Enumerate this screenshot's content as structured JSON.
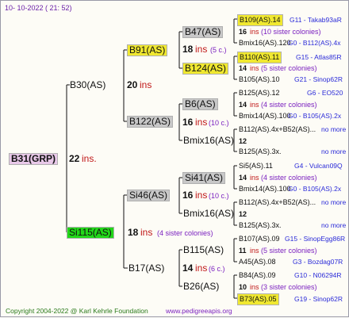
{
  "header": {
    "date": "10- 10-2022 ( 21: 52)"
  },
  "footer": {
    "copyright": "Copyright 2004-2022 @ Karl Kehrle Foundation",
    "site": "www.pedigreeapis.org"
  },
  "colors": {
    "yellow": "#f0e830",
    "gray": "#c8c8c8",
    "green": "#22d81a",
    "pink": "#e8c8e8",
    "ins_red": "#c01818",
    "note_purple": "#7a1fbf",
    "source_blue": "#2a2ad8"
  },
  "root": {
    "name": "B31(GRP)",
    "ins_num": "22",
    "ins_label": "ins."
  },
  "g1": [
    {
      "name": "B30(AS)",
      "ins_num": "20",
      "ins_label": "ins"
    },
    {
      "name": "Si115(AS)",
      "ins_num": "18",
      "ins_label": "ins",
      "note": "(4 sister colonies)"
    }
  ],
  "g2": [
    {
      "name": "B91(AS)",
      "ins_num": "18",
      "ins_label": "ins",
      "note": "(5 c.)"
    },
    {
      "name": "B122(AS)",
      "ins_num": "16",
      "ins_label": "ins",
      "note": "(10 c.)"
    },
    {
      "name": "Si46(AS)",
      "ins_num": "16",
      "ins_label": "ins",
      "note": "(10 c.)"
    },
    {
      "name": "B17(AS)",
      "ins_num": "14",
      "ins_label": "ins",
      "note": "(6 c.)"
    }
  ],
  "g3": [
    {
      "name": "B47(AS)"
    },
    {
      "name": "B124(AS)"
    },
    {
      "name": "B6(AS)"
    },
    {
      "name": "Bmix16(AS)"
    },
    {
      "name": "Si41(AS)"
    },
    {
      "name": "Bmix16(AS)"
    },
    {
      "name": "B115(AS)"
    },
    {
      "name": "B26(AS)"
    }
  ],
  "g4": [
    {
      "top": "B109(AS).14",
      "top_src": "G11 - Takab93aR",
      "mid_num": "16",
      "mid_ins": "ins",
      "mid_note": "(10 sister colonies)",
      "bot": "Bmix16(AS).120",
      "bot_src": "G0 - B112(AS).4x"
    },
    {
      "top": "B110(AS).11",
      "top_src": "G15 - Atlas85R",
      "mid_num": "14",
      "mid_ins": "ins",
      "mid_note": "(5 sister colonies)",
      "bot": "B105(AS).10",
      "bot_src": "G21 - Sinop62R"
    },
    {
      "top": "B125(AS).12",
      "top_src": "G6 - EO520",
      "mid_num": "14",
      "mid_ins": "ins",
      "mid_note": "(4 sister colonies)",
      "bot": "Bmix14(AS).100",
      "bot_src": "G0 - B105(AS).2x"
    },
    {
      "top": "B112(AS).4x+B52(AS)...",
      "top_src": "no more",
      "mid_num": "12",
      "mid_ins": "",
      "mid_note": "",
      "bot": "B125(AS).3x.",
      "bot_src": "no more"
    },
    {
      "top": "Si5(AS).11",
      "top_src": "G4 - Vulcan09Q",
      "mid_num": "14",
      "mid_ins": "ins",
      "mid_note": "(4 sister colonies)",
      "bot": "Bmix14(AS).100",
      "bot_src": "G0 - B105(AS).2x"
    },
    {
      "top": "B112(AS).4x+B52(AS)...",
      "top_src": "no more",
      "mid_num": "12",
      "mid_ins": "",
      "mid_note": "",
      "bot": "B125(AS).3x.",
      "bot_src": "no more"
    },
    {
      "top": "B107(AS).09",
      "top_src": "G15 - SinopEgg86R",
      "mid_num": "11",
      "mid_ins": "ins",
      "mid_note": "(5 sister colonies)",
      "bot": "A45(AS).08",
      "bot_src": "G3 - Bozdag07R"
    },
    {
      "top": "B84(AS).09",
      "top_src": "G10 - N06294R",
      "mid_num": "10",
      "mid_ins": "ins",
      "mid_note": "(3 sister colonies)",
      "bot": "B73(AS).05",
      "bot_src": "G19 - Sinop62R"
    }
  ]
}
